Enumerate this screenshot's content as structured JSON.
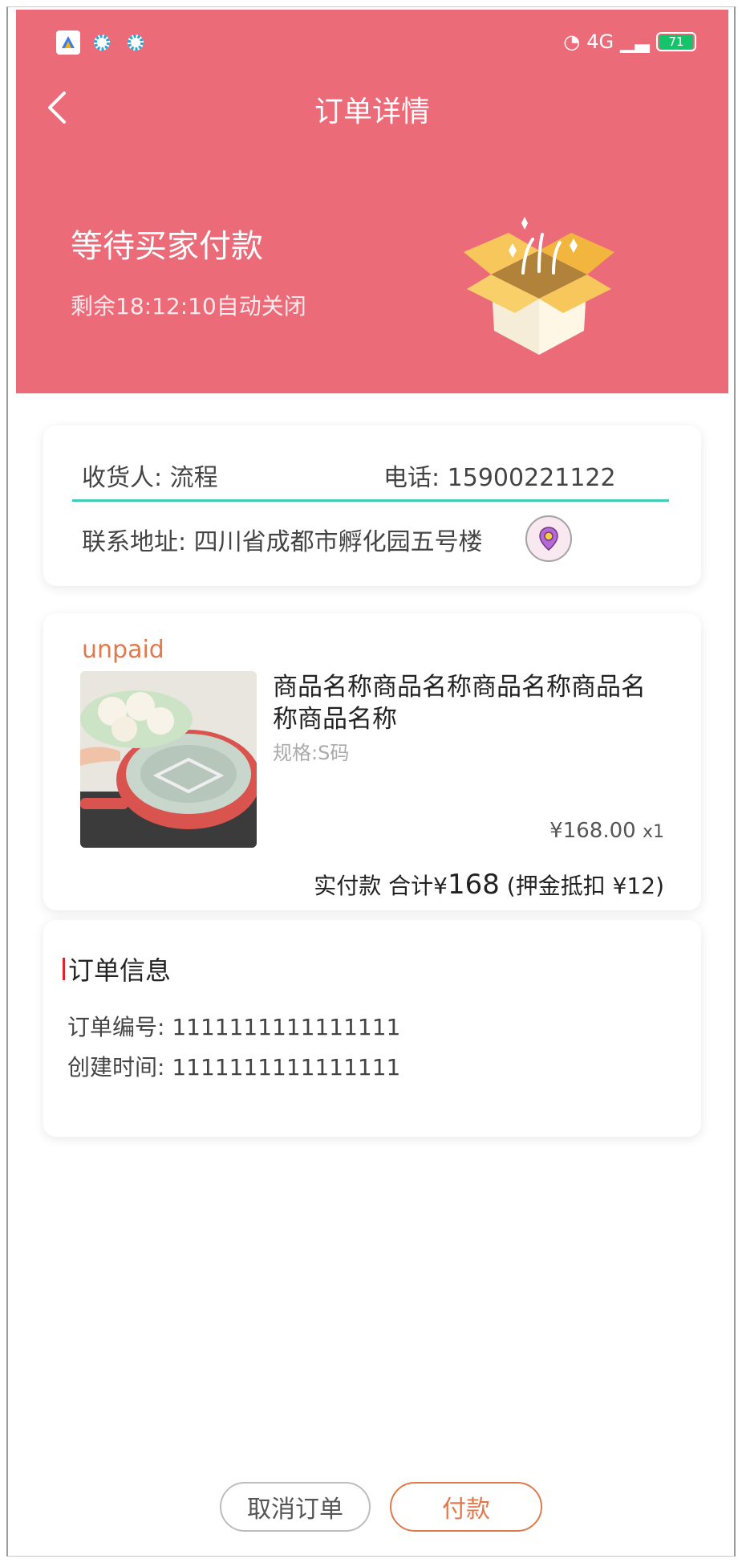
{
  "header": {
    "title": "订单详情",
    "order_status": "等待买家付款",
    "countdown": "剩余18:12:10自动关闭",
    "background_color": "#ec6b78"
  },
  "status_bar": {
    "network": "4G",
    "battery": "71"
  },
  "address": {
    "receiver": "收货人: 流程",
    "phone": "电话: 15900221122",
    "address": "联系地址: 四川省成都市孵化园五号楼",
    "location_icon": "map-pin-icon"
  },
  "product": {
    "status": "unpaid",
    "name": "商品名称商品名称商品名称商品名称商品名称",
    "spec": "规格:S码",
    "price": "¥168.00",
    "quantity": "x1",
    "total_prefix": "实付款 合计¥",
    "total_amount": "168",
    "deposit_note": "(押金抵扣 ¥12)"
  },
  "order_info": {
    "title": "订单信息",
    "order_no": "订单编号: 1111111111111111",
    "create_time": "创建时间: 1111111111111111"
  },
  "actions": {
    "cancel_label": "取消订单",
    "pay_label": "付款",
    "accent_color": "#e07a4c"
  }
}
